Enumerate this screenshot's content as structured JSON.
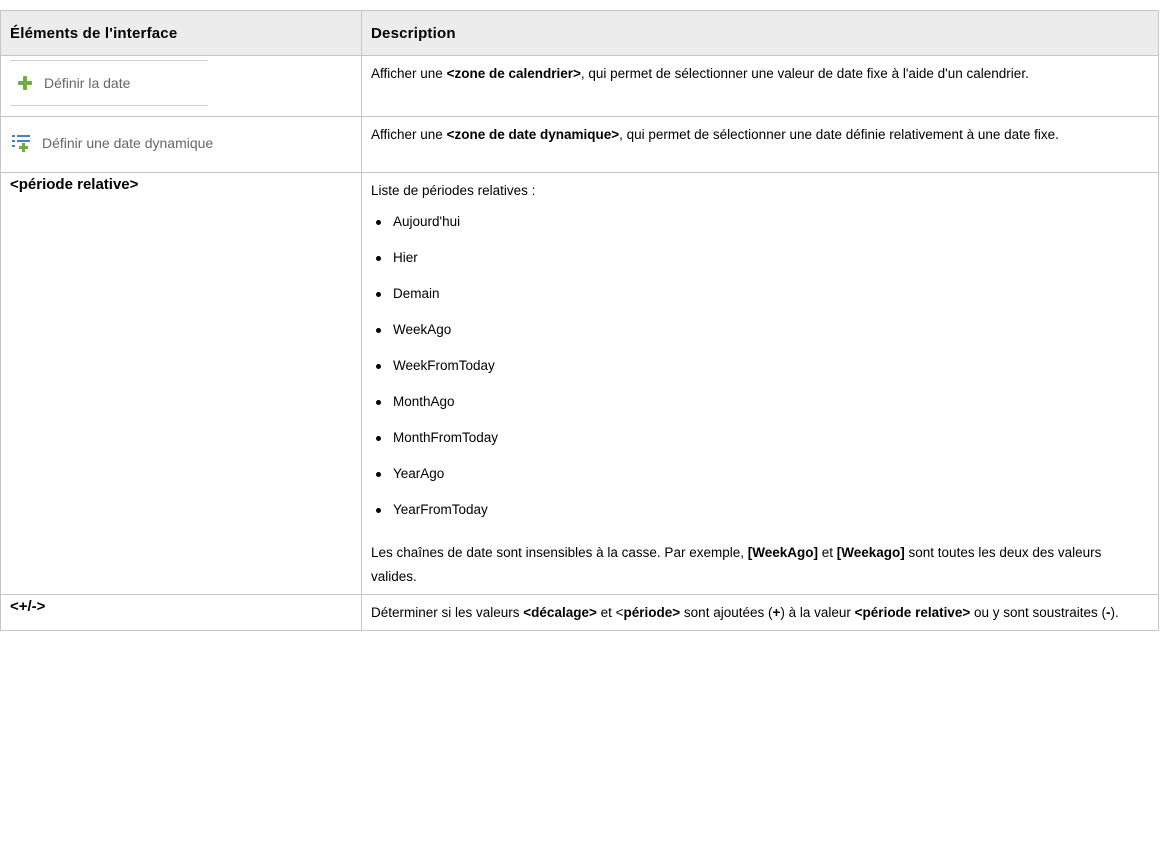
{
  "header": {
    "col1": "Éléments de l'interface",
    "col2": "Description"
  },
  "rows": {
    "set_date": {
      "button_label": "Définir la date",
      "desc": [
        "Afficher une ",
        "<zone de calendrier>",
        ", qui permet de sélectionner une valeur de date fixe à l'aide d'un calendrier."
      ]
    },
    "set_dynamic": {
      "button_label": "Définir une date dynamique",
      "desc": [
        "Afficher une ",
        "<zone de date dynamique>",
        ", qui permet de sélectionner une date définie relativement à une date fixe."
      ]
    },
    "relative_period": {
      "label": "<période relative>",
      "intro": "Liste de périodes relatives :",
      "items": [
        "Aujourd'hui",
        "Hier",
        "Demain",
        "WeekAgo",
        "WeekFromToday",
        "MonthAgo",
        "MonthFromToday",
        "YearAgo",
        "YearFromToday"
      ],
      "note": [
        "Les chaînes de date sont insensibles à la casse. Par exemple, ",
        "[WeekAgo]",
        " et ",
        "[Weekago]",
        " sont toutes les deux des valeurs valides."
      ]
    },
    "plus_minus": {
      "label": "<+/->",
      "desc": [
        "Déterminer si les valeurs ",
        "<décalage>",
        " et <",
        "période>",
        " sont ajoutées (",
        "+",
        ") à la valeur ",
        "<période relative>",
        " ou y sont soustraites (",
        "-",
        ")."
      ]
    }
  },
  "icons": {
    "set_date": "plus-icon",
    "set_dynamic": "dynamic-date-icon"
  },
  "colors": {
    "header_bg": "#ececec",
    "border": "#c6c6c6",
    "plus_green": "#6fae3e"
  }
}
